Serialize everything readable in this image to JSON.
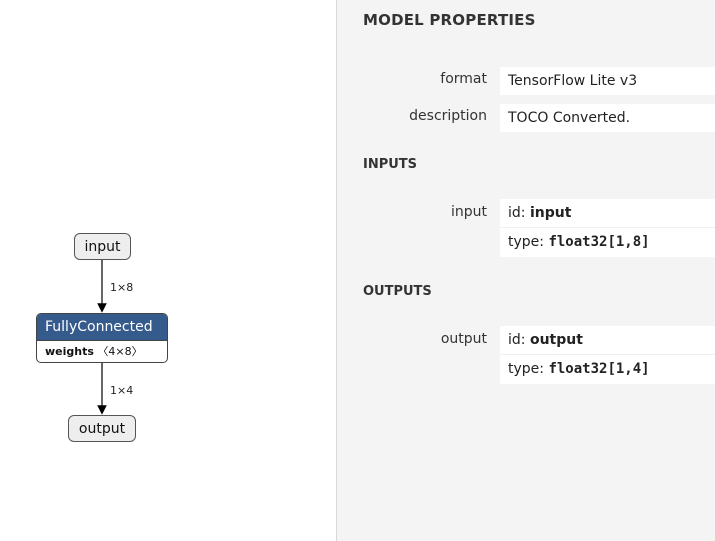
{
  "graph": {
    "input_node": "input",
    "output_node": "output",
    "op_node": {
      "title": "FullyConnected",
      "attr_name": "weights",
      "attr_value": "〈4×8〉"
    },
    "edges": [
      {
        "label": "1×8"
      },
      {
        "label": "1×4"
      }
    ]
  },
  "sidebar": {
    "title": "MODEL PROPERTIES",
    "properties": {
      "format_label": "format",
      "format_value": "TensorFlow Lite v3",
      "description_label": "description",
      "description_value": "TOCO Converted."
    },
    "inputs": {
      "title": "INPUTS",
      "label": "input",
      "id_key": "id: ",
      "id_value": "input",
      "type_key": "type: ",
      "type_value": "float32[1,8]"
    },
    "outputs": {
      "title": "OUTPUTS",
      "label": "output",
      "id_key": "id: ",
      "id_value": "output",
      "type_key": "type: ",
      "type_value": "float32[1,4]"
    }
  },
  "colors": {
    "op_header": "#355a8c",
    "node_fill": "#eeeeee",
    "sidebar_bg": "#f4f4f4"
  }
}
